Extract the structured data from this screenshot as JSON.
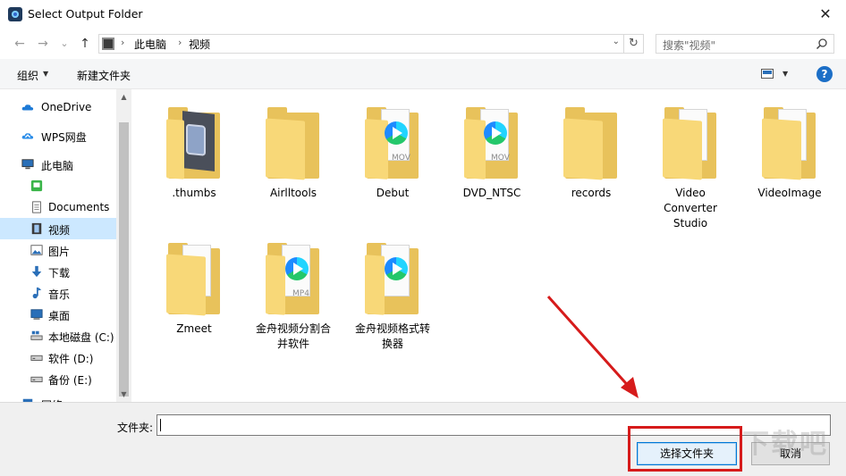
{
  "window": {
    "title": "Select Output Folder",
    "close_glyph": "✕"
  },
  "nav": {
    "back": "←",
    "forward": "→",
    "recent": "⌄",
    "up": "↑"
  },
  "address": {
    "crumbs": [
      "此电脑",
      "视频"
    ],
    "separator": "›",
    "dropdown": "⌄",
    "refresh": "↻",
    "search_placeholder": "搜索\"视频\""
  },
  "toolbar": {
    "organize_label": "组织",
    "new_folder_label": "新建文件夹",
    "help_label": "?"
  },
  "sidebar": {
    "items": [
      {
        "label": "OneDrive",
        "icon": "cloud-icon"
      },
      {
        "label": "WPS网盘",
        "icon": "wps-cloud-icon"
      },
      {
        "label": "此电脑",
        "icon": "computer-icon"
      },
      {
        "label": "",
        "icon": "green-app-icon"
      },
      {
        "label": "Documents",
        "icon": "documents-icon"
      },
      {
        "label": "视频",
        "icon": "video-icon",
        "selected": true
      },
      {
        "label": "图片",
        "icon": "pictures-icon"
      },
      {
        "label": "下载",
        "icon": "download-icon"
      },
      {
        "label": "音乐",
        "icon": "music-icon"
      },
      {
        "label": "桌面",
        "icon": "desktop-icon"
      },
      {
        "label": "本地磁盘 (C:)",
        "icon": "drive-c-icon"
      },
      {
        "label": "软件 (D:)",
        "icon": "drive-icon"
      },
      {
        "label": "备份 (E:)",
        "icon": "drive-icon"
      },
      {
        "label": "网络",
        "icon": "network-icon"
      }
    ]
  },
  "folders": [
    {
      "name": ".thumbs",
      "kind": "thumbs"
    },
    {
      "name": "Airlltools",
      "kind": "plain"
    },
    {
      "name": "Debut",
      "kind": "video",
      "ext": "MOV"
    },
    {
      "name": "DVD_NTSC",
      "kind": "video",
      "ext": "MOV"
    },
    {
      "name": "records",
      "kind": "plain"
    },
    {
      "name": "Video Converter Studio",
      "kind": "doc"
    },
    {
      "name": "VideoImage",
      "kind": "doc"
    },
    {
      "name": "Zmeet",
      "kind": "doc"
    },
    {
      "name": "金舟视频分割合并软件",
      "kind": "video",
      "ext": "MP4"
    },
    {
      "name": "金舟视频格式转换器",
      "kind": "video",
      "ext": ""
    }
  ],
  "bottom": {
    "folder_label": "文件夹:",
    "folder_value": "",
    "select_button": "选择文件夹",
    "cancel_button": "取消"
  },
  "watermark": "下载吧",
  "colors": {
    "selection": "#cce8ff",
    "folder": "#f8d878",
    "highlight": "#d61b1b",
    "accent": "#0078d7"
  }
}
